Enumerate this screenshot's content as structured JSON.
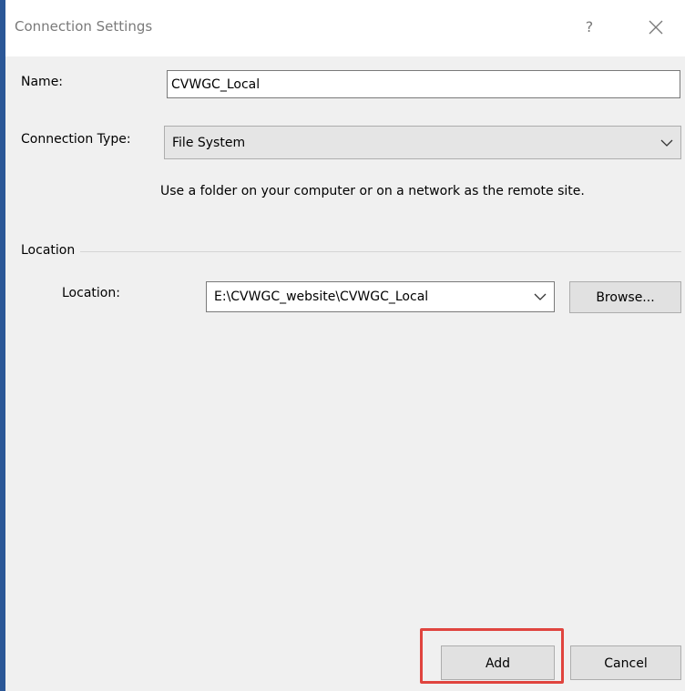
{
  "window": {
    "title": "Connection Settings",
    "help_label": "?",
    "close_icon": "close-icon"
  },
  "form": {
    "name_label": "Name:",
    "name_value": "CVWGC_Local",
    "connection_type_label": "Connection Type:",
    "connection_type_value": "File System",
    "description": "Use a folder on your computer or on a network as the remote site."
  },
  "location_group": {
    "title": "Location",
    "location_label": "Location:",
    "location_value": "E:\\CVWGC_website\\CVWGC_Local",
    "browse_label": "Browse..."
  },
  "buttons": {
    "add_label": "Add",
    "cancel_label": "Cancel"
  },
  "colors": {
    "accent_border": "#2b5797",
    "highlight": "#e0443e"
  }
}
